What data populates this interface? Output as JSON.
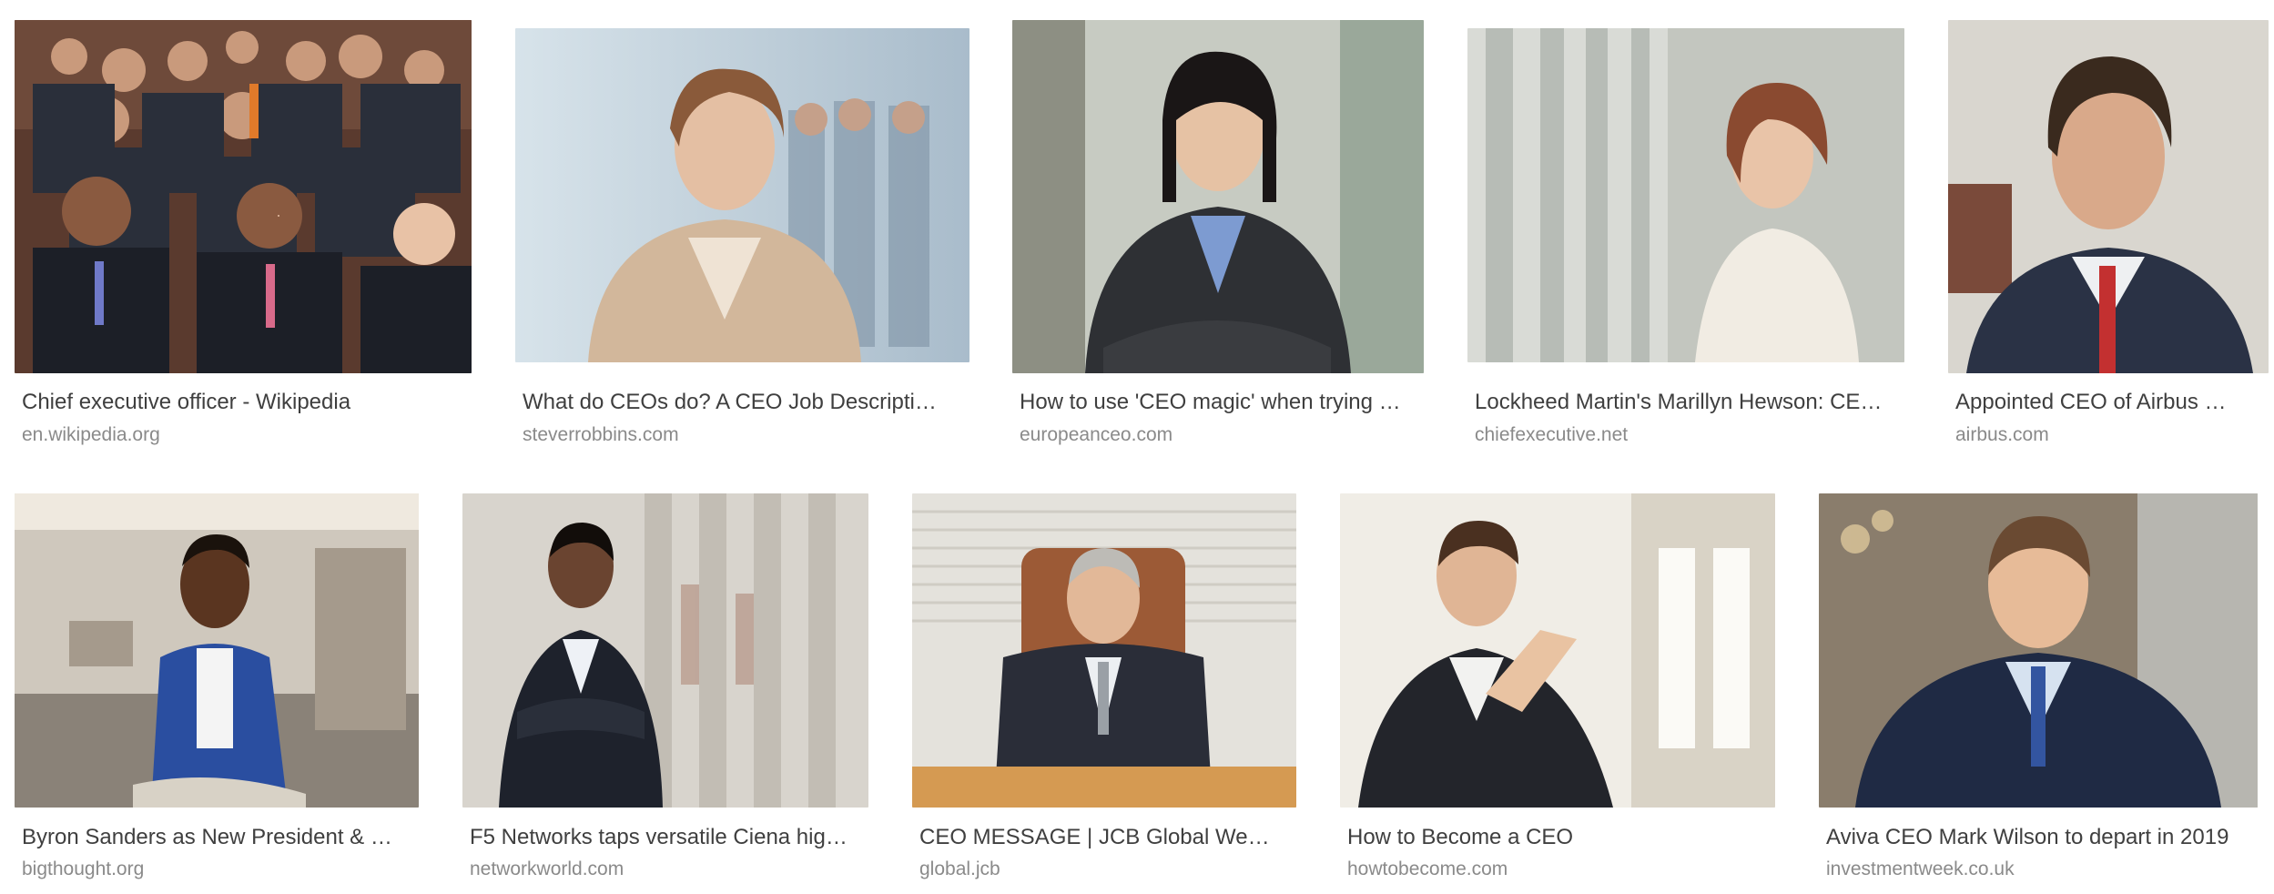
{
  "results": [
    {
      "title": "Chief executive officer - Wikipedia",
      "source": "en.wikipedia.org",
      "image": "group-of-executives-photo"
    },
    {
      "title": "What do CEOs do? A CEO Job Descripti…",
      "source": "steverrobbins.com",
      "image": "businesswoman-portrait-photo"
    },
    {
      "title": "How to use 'CEO magic' when trying …",
      "source": "europeanceo.com",
      "image": "businesswoman-arms-crossed-photo"
    },
    {
      "title": "Lockheed Martin's Marillyn Hewson: CE…",
      "source": "chiefexecutive.net",
      "image": "executive-woman-office-photo"
    },
    {
      "title": "Appointed CEO of Airbus …",
      "source": "airbus.com",
      "image": "businessman-portrait-photo"
    },
    {
      "title": "Byron Sanders as New President & …",
      "source": "bigthought.org",
      "image": "man-blue-blazer-seated-photo"
    },
    {
      "title": "F5 Networks taps versatile Ciena hig…",
      "source": "networkworld.com",
      "image": "businessman-arms-crossed-photo"
    },
    {
      "title": "CEO MESSAGE | JCB Global We…",
      "source": "global.jcb",
      "image": "executive-at-desk-photo"
    },
    {
      "title": "How to Become a CEO",
      "source": "howtobecome.com",
      "image": "businessman-thinking-photo"
    },
    {
      "title": "Aviva CEO Mark Wilson to depart in 2019",
      "source": "investmentweek.co.uk",
      "image": "smiling-executive-photo"
    }
  ]
}
